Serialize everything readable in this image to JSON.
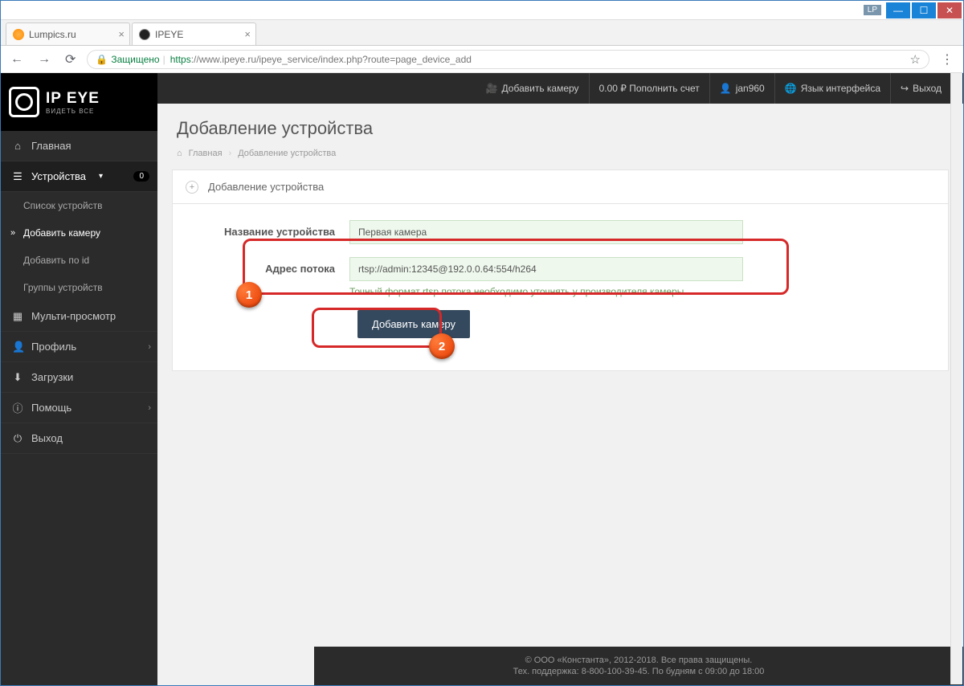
{
  "window": {
    "tag": "LP"
  },
  "tabs": [
    {
      "title": "Lumpics.ru"
    },
    {
      "title": "IPEYE"
    }
  ],
  "addressbar": {
    "secure_label": "Защищено",
    "url_prefix": "https",
    "url_rest": "://www.ipeye.ru/ipeye_service/index.php?route=page_device_add"
  },
  "topnav": {
    "add_camera": "Добавить камеру",
    "balance": "0.00 ₽ Пополнить счет",
    "user": "jan960",
    "language": "Язык интерфейса",
    "logout": "Выход"
  },
  "logo": {
    "title": "IP EYE",
    "sub": "ВИДЕТЬ ВСЕ"
  },
  "sidebar": {
    "home": "Главная",
    "devices": "Устройства",
    "devices_badge": "0",
    "device_list": "Список устройств",
    "add_camera": "Добавить камеру",
    "add_by_id": "Добавить по id",
    "device_groups": "Группы устройств",
    "multiview": "Мульти-просмотр",
    "profile": "Профиль",
    "downloads": "Загрузки",
    "help": "Помощь",
    "logout": "Выход"
  },
  "page": {
    "title": "Добавление устройства",
    "crumb_home": "Главная",
    "crumb_current": "Добавление устройства",
    "panel_title": "Добавление устройства"
  },
  "form": {
    "name_label": "Название устройства",
    "name_value": "Первая камера",
    "stream_label": "Адрес потока",
    "stream_value": "rtsp://admin:12345@192.0.0.64:554/h264",
    "stream_hint": "Точный формат rtsp потока необходимо уточнять у производителя камеры",
    "submit": "Добавить камеру"
  },
  "footer": {
    "line1": "© ООО «Константа», 2012-2018. Все права защищены.",
    "line2": "Тех. поддержка: 8-800-100-39-45. По будням с 09:00 до 18:00"
  },
  "annotations": {
    "n1": "1",
    "n2": "2"
  }
}
